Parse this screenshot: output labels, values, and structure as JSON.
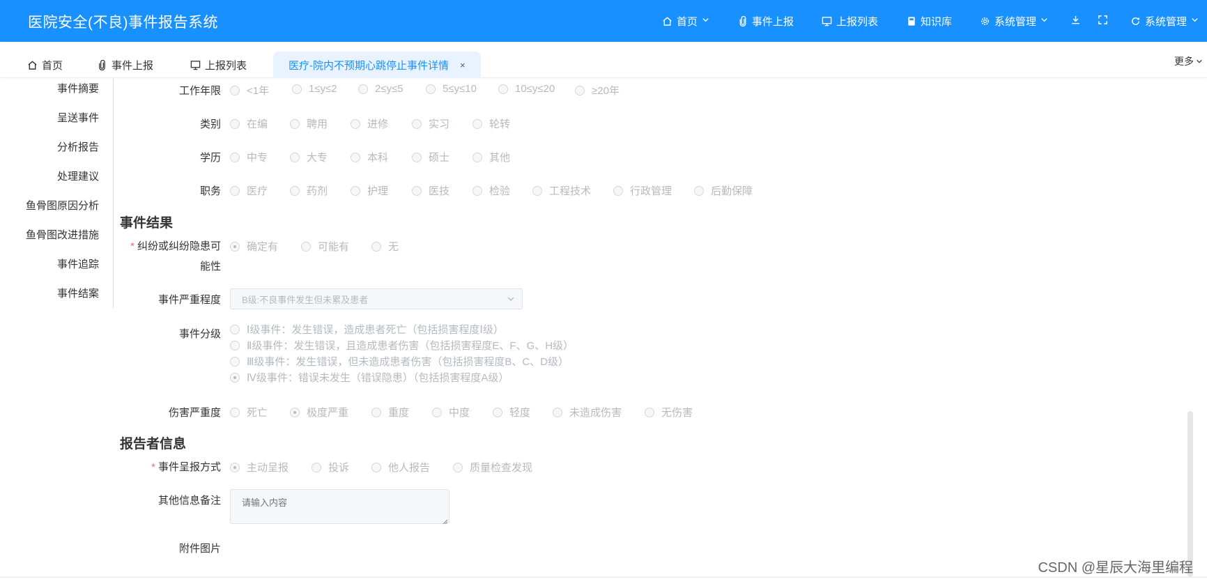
{
  "header": {
    "title": "医院安全(不良)事件报告系统",
    "nav": [
      {
        "label": "首页"
      },
      {
        "label": "事件上报"
      },
      {
        "label": "上报列表"
      },
      {
        "label": "知识库"
      },
      {
        "label": "系统管理"
      },
      {
        "label": "系统管理"
      }
    ]
  },
  "tabs": {
    "items": [
      {
        "label": "首页"
      },
      {
        "label": "事件上报"
      },
      {
        "label": "上报列表"
      },
      {
        "label": "医疗-院内不预期心跳停止事件详情"
      }
    ],
    "close": "×",
    "more_label": "更多"
  },
  "anchor_menu": [
    "事件摘要",
    "呈送事件",
    "分析报告",
    "处理建议",
    "鱼骨图原因分析",
    "鱼骨图改进措施",
    "事件追踪",
    "事件结案"
  ],
  "form": {
    "work_years": {
      "label": "工作年限",
      "options": [
        "<1年",
        "1≤y≤2",
        "2≤y≤5",
        "5≤y≤10",
        "10≤y≤20",
        "≥20年"
      ]
    },
    "category": {
      "label": "类别",
      "options": [
        "在编",
        "聘用",
        "进修",
        "实习",
        "轮转"
      ]
    },
    "education": {
      "label": "学历",
      "options": [
        "中专",
        "大专",
        "本科",
        "硕士",
        "其他"
      ]
    },
    "position": {
      "label": "职务",
      "options": [
        "医疗",
        "药剂",
        "护理",
        "医技",
        "检验",
        "工程技术",
        "行政管理",
        "后勤保障"
      ]
    }
  },
  "result_section": {
    "title": "事件结果",
    "dispute": {
      "label_line1": "纠纷或纠纷隐患可",
      "label_line2": "能性",
      "required": "*",
      "options": [
        "确定有",
        "可能有",
        "无"
      ],
      "selected": "确定有"
    },
    "severity": {
      "label": "事件严重程度",
      "value": "B级:不良事件发生但未累及患者"
    },
    "grade": {
      "label": "事件分级",
      "options": [
        "Ⅰ级事件：发生错误，造成患者死亡（包括损害程度Ⅰ级）",
        "Ⅱ级事件：发生错误，且造成患者伤害（包括损害程度E、F、G、H级）",
        "Ⅲ级事件：发生错误，但未造成患者伤害（包括损害程度B、C、D级）",
        "Ⅳ级事件：错误未发生（错误隐患）（包括损害程度A级）"
      ],
      "selected": "Ⅳ级事件：错误未发生（错误隐患）（包括损害程度A级）"
    },
    "injury": {
      "label": "伤害严重度",
      "options": [
        "死亡",
        "极度严重",
        "重度",
        "中度",
        "轻度",
        "未造成伤害",
        "无伤害"
      ],
      "selected": "极度严重"
    }
  },
  "reporter_section": {
    "title": "报告者信息",
    "method": {
      "label": "事件呈报方式",
      "required": "*",
      "options": [
        "主动呈报",
        "投诉",
        "他人报告",
        "质量检查发现"
      ],
      "selected": "主动呈报"
    },
    "notes": {
      "label": "其他信息备注",
      "placeholder": "请输入内容"
    },
    "attachment": {
      "label": "附件图片"
    }
  },
  "watermark": "CSDN @星辰大海里编程",
  "colors": {
    "primary": "#1890ff",
    "tab_active_bg": "#e8f3ff",
    "required": "#f56c6c",
    "disabled_text": "#b5b9c0"
  }
}
